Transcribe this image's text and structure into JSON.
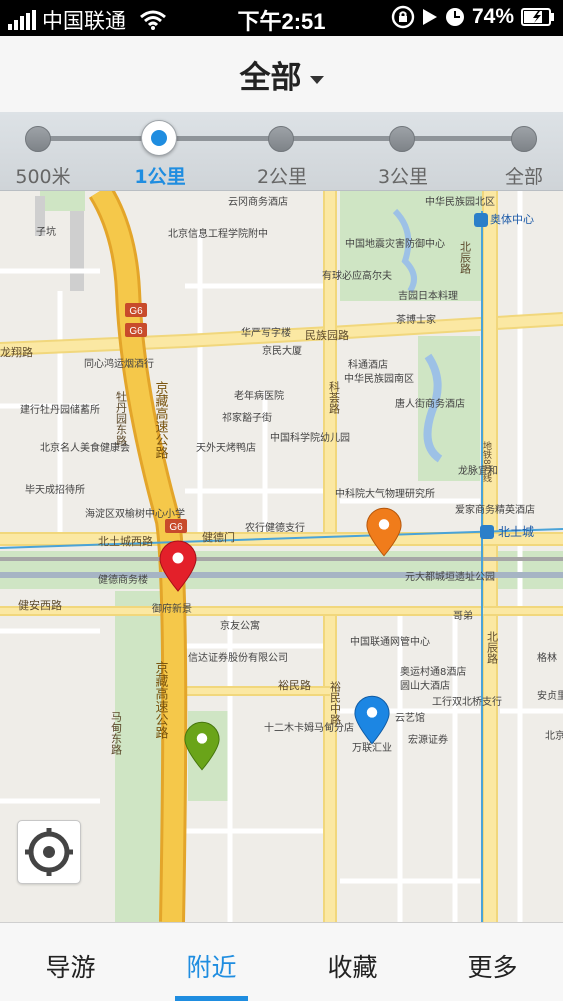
{
  "status_bar": {
    "carrier": "中国联通",
    "time": "下午2:51",
    "battery": "74%"
  },
  "header": {
    "title": "全部"
  },
  "range_selector": {
    "stops": [
      {
        "label": "500米",
        "active": false
      },
      {
        "label": "1公里",
        "active": true
      },
      {
        "label": "2公里",
        "active": false
      },
      {
        "label": "3公里",
        "active": false
      },
      {
        "label": "全部",
        "active": false
      }
    ]
  },
  "map": {
    "road_labels": {
      "minzuyuan": "民族园路",
      "longxiang": "龙翔路",
      "jingzang": "京藏高速公路",
      "beitucheng": "北土城西路",
      "jianan": "健安西路",
      "yumin": "裕民路",
      "beichen": "北辰路",
      "beichen2": "北辰路",
      "kexuyuan": "科荟路",
      "mudanyuan": "牡丹园东路",
      "madian": "马甸东路",
      "yumin_nan": "裕民中路",
      "jiande": "健德门",
      "metro": "地铁8号线",
      "g6": "G6",
      "g6b": "G6"
    },
    "pois": {
      "yungang": "云冈商务酒店",
      "zhonghuamz": "中华民族园北区",
      "aotizx": "奥体中心",
      "beixinxi": "北京信息工程学院附中",
      "zhongguodz": "中国地震灾害防御中心",
      "youqiu": "有球必应高尔夫",
      "jiri": "吉园日本料理",
      "chamao": "茶博士家",
      "huachan": "华严写字楼",
      "jingmin": "京民大厦",
      "tongxin": "同心鸿运烟酒行",
      "kehe": "科通酒店",
      "zhonghuamzn": "中华民族园南区",
      "laonian": "老年病医院",
      "tangren": "唐人街商务酒店",
      "jianxing": "建行牡丹园储蓄所",
      "qixiang": "祁家豁子街",
      "tianwai": "天外天烤鸭店",
      "zhongkeyou": "中国科学院幼儿园",
      "beijingmr": "北京名人美食健康会",
      "biyu": "毕天成招待所",
      "longmao": "龙脉宜和",
      "zhongkeqx": "中科院大气物理研究所",
      "aijia": "爱家商务精英酒店",
      "haidian": "海淀区双榆树中心小学",
      "nonghang": "农行健德支行",
      "beitucheng_st": "北土城",
      "yuandadu": "元大都城垣遗址公园",
      "jiankang": "健德商务楼",
      "yujing": "御府新景",
      "jingyou": "京友公寓",
      "xindaoz": "信达证券股份有限公司",
      "zhongguolt": "中国联通网管中心",
      "aoyuncun": "奥运村通8酒店",
      "yuanshan": "圆山大酒店",
      "gongxing": "工行双北桥支行",
      "shierjia": "十二木卡姆马甸分店",
      "wanlian": "万联汇业",
      "hongyuan": "宏源证券",
      "gebei": "哥弟",
      "gelin": "格林",
      "anqing": "安贞里",
      "beijing_eng": "北京英",
      "yunyi": "云艺馆",
      "zixun": "子坑"
    },
    "pin_colors": {
      "red": "#e3202a",
      "orange": "#f07c1b",
      "green": "#6aa419",
      "blue": "#1c86e3"
    }
  },
  "tabs": [
    {
      "label": "导游",
      "active": false
    },
    {
      "label": "附近",
      "active": true
    },
    {
      "label": "收藏",
      "active": false
    },
    {
      "label": "更多",
      "active": false
    }
  ],
  "colors": {
    "accent": "#1f8de0",
    "highway": "#f5c84a",
    "major_road": "#fbe8a3"
  },
  "icons": [
    "signal-icon",
    "wifi-icon",
    "rotation-lock-icon",
    "play-icon",
    "alarm-icon",
    "battery-icon",
    "dropdown-caret-icon",
    "locate-icon",
    "map-pin-icon",
    "metro-station-icon"
  ]
}
